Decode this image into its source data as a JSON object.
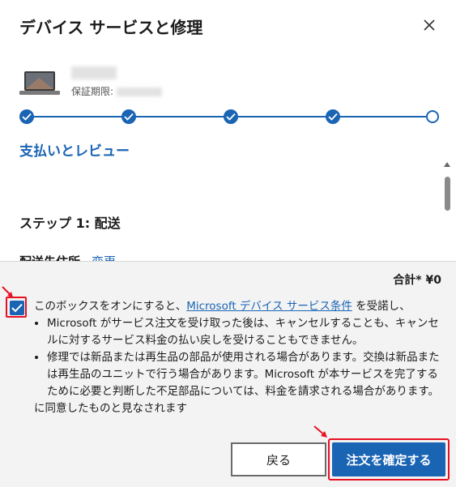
{
  "dialog": {
    "title": "デバイス サービスと修理",
    "warranty_label": "保証期限:",
    "section_title": "支払いとレビュー",
    "step_heading": "ステップ 1: 配送",
    "shipping_label": "配送先住所",
    "change_link": "変更",
    "stepper": {
      "completed_steps": 4,
      "total_steps": 5
    }
  },
  "footer": {
    "total": "合計* ¥0",
    "checkbox_checked": true,
    "intro_before": "このボックスをオンにすると、",
    "terms_link": "Microsoft デバイス サービス条件",
    "intro_after": " を受諾し、",
    "bullets": [
      "Microsoft がサービス注文を受け取った後は、キャンセルすることも、キャンセルに対するサービス料金の払い戻しを受けることもできません。",
      "修理では新品または再生品の部品が使用される場合があります。交換は新品または再生品のユニットで行う場合があります。Microsoft が本サービスを完了するために必要と判断した不足部品については、料金を請求される場合があります。"
    ],
    "agree_text": "に同意したものと見なされます",
    "back_label": "戻る",
    "confirm_label": "注文を確定する"
  },
  "colors": {
    "accent": "#1a64b4",
    "annotation": "#e81123"
  }
}
